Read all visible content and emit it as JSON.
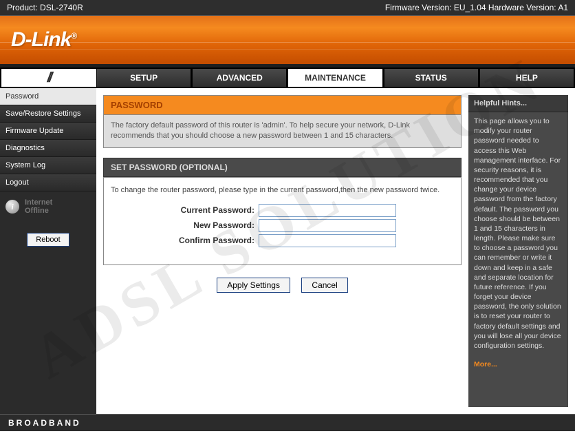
{
  "topbar": {
    "product_label": "Product:",
    "product_value": "DSL-2740R",
    "firmware_label": "Firmware Version:",
    "firmware_value": "EU_1.04",
    "hardware_label": "Hardware Version:",
    "hardware_value": "A1"
  },
  "brand": "D-Link",
  "nav": {
    "slash": "//",
    "tabs": [
      "SETUP",
      "ADVANCED",
      "MAINTENANCE",
      "STATUS",
      "HELP"
    ],
    "active": "MAINTENANCE"
  },
  "sidebar": {
    "items": [
      "Password",
      "Save/Restore Settings",
      "Firmware Update",
      "Diagnostics",
      "System Log",
      "Logout"
    ],
    "active": "Password",
    "status_label_line1": "Internet",
    "status_label_line2": "Offline",
    "reboot_label": "Reboot"
  },
  "page": {
    "title": "PASSWORD",
    "desc": "The factory default password of this router is 'admin'. To help secure your network, D-Link recommends that you should choose a new password between 1 and 15 characters.",
    "subheader": "SET PASSWORD (OPTIONAL)",
    "form_instruction": "To change the router password, please type in the current password,then the new password twice.",
    "labels": {
      "current": "Current Password:",
      "new": "New Password:",
      "confirm": "Confirm Password:"
    },
    "buttons": {
      "apply": "Apply Settings",
      "cancel": "Cancel"
    }
  },
  "hints": {
    "title": "Helpful Hints...",
    "body": "This page allows you to modify your router password needed to access this Web management interface. For security reasons, it is recommended that you change your device password from the factory default. The password you choose should be between 1 and 15 characters in length. Please make sure to choose a password you can remember or write it down and keep in a safe and separate location for future reference. If you forget your device password, the only solution is to reset your router to factory default settings and you will lose all your device configuration settings.",
    "more": "More..."
  },
  "footer": "BROADBAND",
  "watermark": "ADSL SOLUTION"
}
